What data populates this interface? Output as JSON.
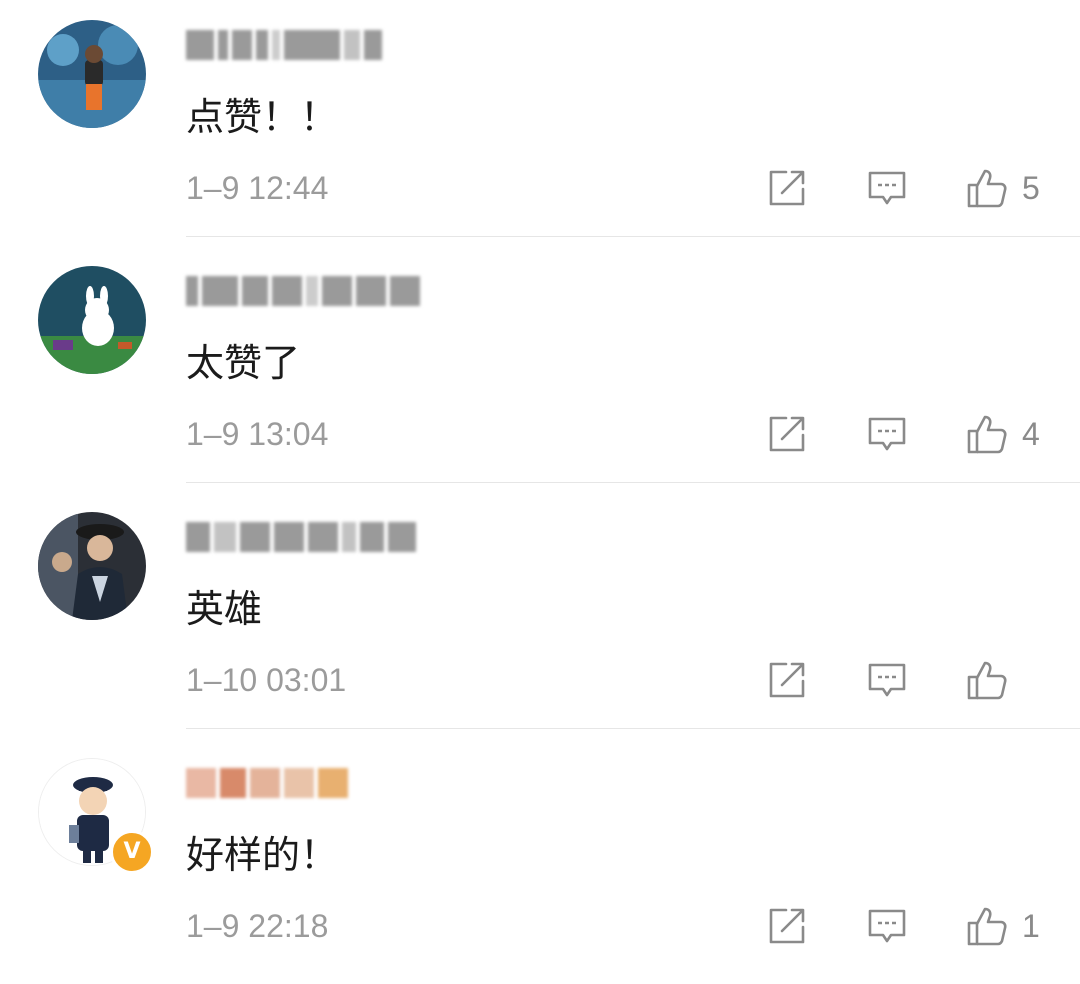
{
  "comments": [
    {
      "text": "点赞！！",
      "time": "1–9 12:44",
      "likes": "5",
      "avatar_icon": "child-aquarium-photo",
      "username_blurred": true
    },
    {
      "text": "太赞了",
      "time": "1–9 13:04",
      "likes": "4",
      "avatar_icon": "cartoon-bunny-picnic",
      "username_blurred": true
    },
    {
      "text": "英雄",
      "time": "1–10 03:01",
      "likes": "",
      "avatar_icon": "man-in-hat-photo",
      "username_blurred": true
    },
    {
      "text": "好样的！",
      "time": "1–9 22:18",
      "likes": "1",
      "avatar_icon": "cartoon-police-officer",
      "verified_badge": "V",
      "username_blurred": true
    }
  ],
  "icons": {
    "share": "share-icon",
    "reply": "comment-icon",
    "like": "thumbs-up-icon"
  },
  "colors": {
    "text": "#1b1b1b",
    "meta": "#9b9b9b",
    "icon": "#8a8a8a",
    "verified": "#f5a623"
  }
}
